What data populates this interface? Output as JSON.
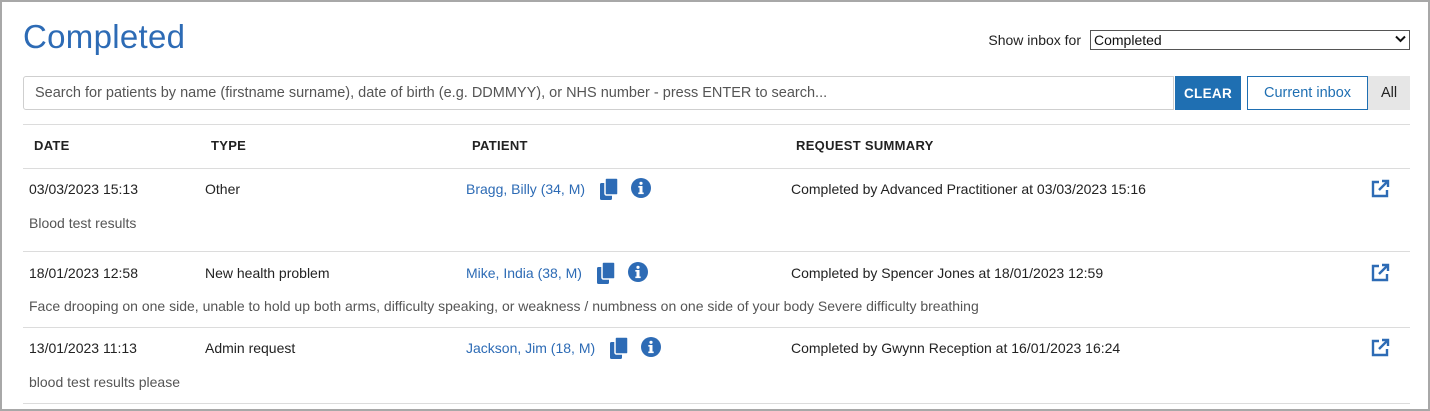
{
  "header": {
    "title": "Completed",
    "inbox_label": "Show inbox for",
    "inbox_selected": "Completed"
  },
  "search": {
    "placeholder": "Search for patients by name (firstname surname), date of birth (e.g. DDMMYY), or NHS number - press ENTER to search...",
    "value": "",
    "clear_label": "CLEAR",
    "current_inbox_label": "Current inbox",
    "all_label": "All"
  },
  "table": {
    "columns": {
      "date": "DATE",
      "type": "TYPE",
      "patient": "PATIENT",
      "summary": "REQUEST SUMMARY"
    },
    "rows": [
      {
        "date": "03/03/2023 15:13",
        "type": "Other",
        "patient": "Bragg, Billy (34, M)",
        "completed": "Completed by Advanced Practitioner at 03/03/2023 15:16",
        "details": "Blood test results"
      },
      {
        "date": "18/01/2023 12:58",
        "type": "New health problem",
        "patient": "Mike, India (38, M)",
        "completed": "Completed by Spencer Jones at 18/01/2023 12:59",
        "details": "Face drooping on one side, unable to hold up both arms, difficulty speaking, or weakness / numbness on one side of your body Severe difficulty breathing"
      },
      {
        "date": "13/01/2023 11:13",
        "type": "Admin request",
        "patient": "Jackson, Jim (18, M)",
        "completed": "Completed by Gwynn Reception at 16/01/2023 16:24",
        "details": "blood test results please"
      }
    ]
  },
  "icons": {
    "copy": "copy-icon",
    "info": "info-icon",
    "open": "open-external-icon"
  },
  "colors": {
    "accent": "#2d6bb5",
    "button_primary": "#1f6fb2",
    "border": "#dcdcdc"
  }
}
